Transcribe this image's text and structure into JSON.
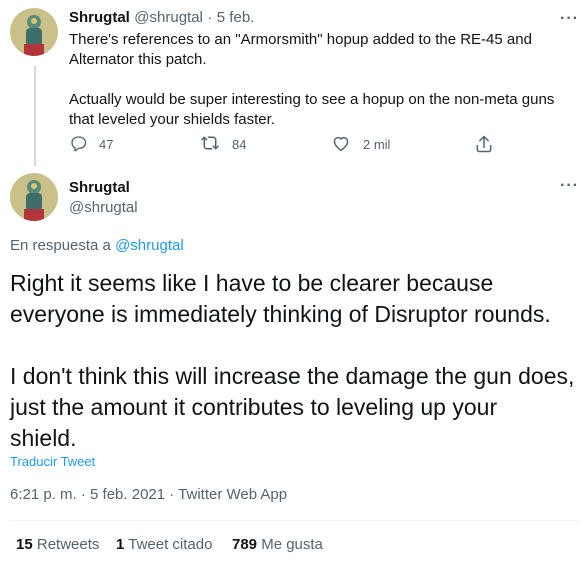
{
  "tweet1": {
    "name": "Shrugtal",
    "handle": "@shrugtal",
    "separator": "·",
    "date": "5 feb.",
    "text": "There's references to an \"Armorsmith\" hopup added to the RE-45 and\nAlternator this patch.\n\nActually would be super interesting to see a hopup on the non-meta guns\nthat leveled your shields faster.",
    "actions": {
      "replies": "47",
      "retweets": "84",
      "likes": "2 mil"
    }
  },
  "tweet2": {
    "name": "Shrugtal",
    "handle": "@shrugtal",
    "reply_prefix": "En respuesta a",
    "reply_to": "@shrugtal",
    "text": "Right it seems like I have to be clearer because\neveryone is immediately thinking of Disruptor rounds.\n\nI don't think this will increase the damage the gun does,\njust the amount it contributes to leveling up your\nshield.",
    "translate": "Traducir Tweet",
    "timestamp": "6:21 p. m. · 5 feb. 2021 · Twitter Web App",
    "stats": {
      "retweets_count": "15",
      "retweets_label": "Retweets",
      "quotes_count": "1",
      "quotes_label": "Tweet citado",
      "likes_count": "789",
      "likes_label": "Me gusta"
    }
  },
  "more_glyph": "···",
  "colors": {
    "accent": "#1d9bf0",
    "text": "#0f1419",
    "muted": "#536471",
    "line": "#cfd9de"
  },
  "icons": {
    "reply": "reply-icon",
    "retweet": "retweet-icon",
    "like": "heart-icon",
    "share": "share-icon",
    "more": "more-icon"
  }
}
